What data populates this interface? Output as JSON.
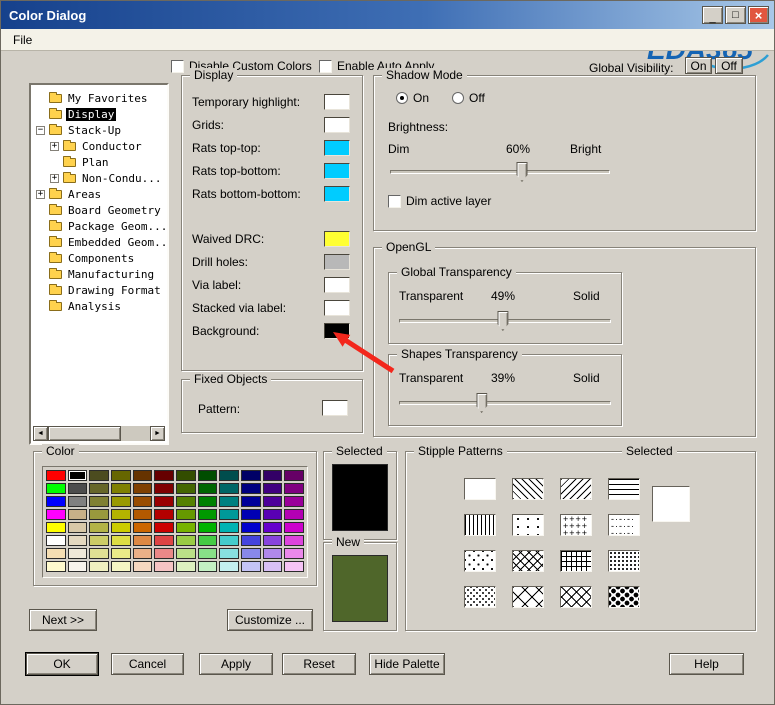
{
  "titlebar": {
    "title": "Color Dialog",
    "minimize_glyph": "_",
    "maximize_glyph": "□",
    "close_glyph": "×"
  },
  "menubar": {
    "file": "File"
  },
  "logo": {
    "text": "EDA365",
    "blue": "#1464b4",
    "orange": "#f7941d"
  },
  "icons": {
    "plus": "+",
    "minus": "−",
    "scroll_left": "◄",
    "scroll_right": "►"
  },
  "topbar": {
    "disable_custom_colors": "Disable Custom Colors",
    "enable_auto_apply": "Enable Auto Apply",
    "global_visibility": "Global Visibility:",
    "on": "On",
    "off": "Off"
  },
  "tree": {
    "items": [
      {
        "label": "My Favorites",
        "indent": 0,
        "expander": null,
        "selected": false
      },
      {
        "label": "Display",
        "indent": 0,
        "expander": null,
        "selected": true
      },
      {
        "label": "Stack-Up",
        "indent": 0,
        "expander": "minus",
        "selected": false
      },
      {
        "label": "Conductor",
        "indent": 1,
        "expander": "plus",
        "selected": false
      },
      {
        "label": "Plan",
        "indent": 1,
        "expander": null,
        "selected": false
      },
      {
        "label": "Non-Condu...",
        "indent": 1,
        "expander": "plus",
        "selected": false
      },
      {
        "label": "Areas",
        "indent": 0,
        "expander": "plus",
        "selected": false
      },
      {
        "label": "Board Geometry",
        "indent": 0,
        "expander": null,
        "selected": false
      },
      {
        "label": "Package Geom...",
        "indent": 0,
        "expander": null,
        "selected": false
      },
      {
        "label": "Embedded Geom...",
        "indent": 0,
        "expander": null,
        "selected": false
      },
      {
        "label": "Components",
        "indent": 0,
        "expander": null,
        "selected": false
      },
      {
        "label": "Manufacturing",
        "indent": 0,
        "expander": null,
        "selected": false
      },
      {
        "label": "Drawing Format",
        "indent": 0,
        "expander": null,
        "selected": false
      },
      {
        "label": "Analysis",
        "indent": 0,
        "expander": null,
        "selected": false
      }
    ]
  },
  "display_group": {
    "title": "Display",
    "rows": [
      {
        "label": "Temporary highlight:",
        "color": "#ffffff"
      },
      {
        "label": "Grids:",
        "color": "#ffffff"
      },
      {
        "label": "Rats top-top:",
        "color": "#00ccff"
      },
      {
        "label": "Rats top-bottom:",
        "color": "#00ccff"
      },
      {
        "label": "Rats bottom-bottom:",
        "color": "#00ccff"
      },
      {
        "label": "Waived DRC:",
        "color": "#ffff33",
        "gap_before": true
      },
      {
        "label": "Drill holes:",
        "color": "#b8b8b8"
      },
      {
        "label": "Via label:",
        "color": "#ffffff"
      },
      {
        "label": "Stacked via label:",
        "color": "#ffffff"
      },
      {
        "label": "Background:",
        "color": "#000000"
      }
    ]
  },
  "fixed_objects": {
    "title": "Fixed Objects",
    "pattern_label": "Pattern:",
    "pattern_color": "#ffffff"
  },
  "shadow_mode": {
    "title": "Shadow Mode",
    "on": "On",
    "off": "Off",
    "selected": "On",
    "brightness_label": "Brightness:",
    "dim": "Dim",
    "value": "60%",
    "bright": "Bright",
    "slider_pct": 60,
    "dim_active_layer": "Dim active layer"
  },
  "opengl": {
    "title": "OpenGL",
    "global": {
      "title": "Global Transparency",
      "left": "Transparent",
      "value": "49%",
      "right": "Solid",
      "slider_pct": 49
    },
    "shapes": {
      "title": "Shapes Transparency",
      "left": "Transparent",
      "value": "39%",
      "right": "Solid",
      "slider_pct": 39
    }
  },
  "color_group": {
    "title": "Color",
    "next_button": "Next >>",
    "customize_button": "Customize ...",
    "selected_cell": {
      "row": 0,
      "col": 1
    },
    "palette": [
      [
        "#ff0000",
        "#000000",
        "#4c4c1f",
        "#666600",
        "#663300",
        "#660000",
        "#334d00",
        "#004d00",
        "#004d4d",
        "#000066",
        "#330066",
        "#660066"
      ],
      [
        "#00ff00",
        "#4d4d4d",
        "#666629",
        "#808000",
        "#804000",
        "#800000",
        "#446600",
        "#006600",
        "#006666",
        "#000080",
        "#400080",
        "#800080"
      ],
      [
        "#0000ff",
        "#808080",
        "#808033",
        "#999900",
        "#994d00",
        "#990000",
        "#558000",
        "#008000",
        "#008080",
        "#000099",
        "#4d0099",
        "#990099"
      ],
      [
        "#ff00ff",
        "#c8b088",
        "#99993d",
        "#b3b300",
        "#b35900",
        "#b30000",
        "#669900",
        "#009900",
        "#009999",
        "#0000b3",
        "#5900b3",
        "#b300b3"
      ],
      [
        "#ffff00",
        "#d8c8a8",
        "#b3b347",
        "#cccc00",
        "#cc6600",
        "#cc0000",
        "#77b300",
        "#00b300",
        "#00b3b3",
        "#0000cc",
        "#6600cc",
        "#cc00cc"
      ],
      [
        "#ffffff",
        "#e4d8c0",
        "#cccc66",
        "#dddd44",
        "#dd8844",
        "#dd4444",
        "#99cc44",
        "#44cc44",
        "#44cccc",
        "#4444dd",
        "#8844dd",
        "#dd44dd"
      ],
      [
        "#f5deb3",
        "#efe8d8",
        "#e0e094",
        "#eaea88",
        "#eab088",
        "#ea8888",
        "#bbe088",
        "#88e088",
        "#88e0e0",
        "#8888ea",
        "#b088ea",
        "#ea88ea"
      ],
      [
        "#fffacd",
        "#f8f4ec",
        "#f0f0c0",
        "#f6f6c4",
        "#f6d8c0",
        "#f6c4c4",
        "#ddf0c0",
        "#c4f0c4",
        "#c4f0f0",
        "#c4c4f6",
        "#d8c0f6",
        "#f6c4f6"
      ]
    ]
  },
  "selected_panel": {
    "selected_label": "Selected",
    "selected_color": "#000000",
    "new_label": "New",
    "new_color": "#4f662a"
  },
  "stipple": {
    "title": "Stipple Patterns",
    "selected_label": "Selected",
    "selected_pattern": "solid",
    "patterns": [
      {
        "name": "solid"
      },
      {
        "name": "diagonal-down"
      },
      {
        "name": "diagonal-up"
      },
      {
        "name": "horizontal-lines"
      },
      {
        "name": "vertical-lines"
      },
      {
        "name": "sparse-dots"
      },
      {
        "name": "plus-grid",
        "glyph": "+"
      },
      {
        "name": "dash-dot",
        "glyph": "-·"
      },
      {
        "name": "diagonal-dots"
      },
      {
        "name": "crosshatch"
      },
      {
        "name": "square-grid"
      },
      {
        "name": "dense-dots"
      },
      {
        "name": "stipple-dots"
      },
      {
        "name": "diamond-open"
      },
      {
        "name": "diamond-lattice"
      },
      {
        "name": "polka-dots"
      }
    ]
  },
  "annotation_arrow": {
    "color": "#f3271c"
  },
  "footer": {
    "ok": "OK",
    "cancel": "Cancel",
    "apply": "Apply",
    "reset": "Reset",
    "hide_palette": "Hide Palette",
    "help": "Help"
  }
}
